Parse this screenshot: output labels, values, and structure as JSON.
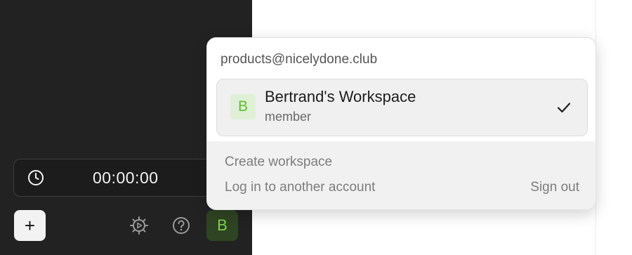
{
  "timer": {
    "time": "00:00:00",
    "icon": "clock-icon"
  },
  "toolbar": {
    "add_label": "+",
    "settings_icon": "gear-icon",
    "help_icon": "help-icon",
    "avatar_initial": "B"
  },
  "account_menu": {
    "email": "products@nicelydone.club",
    "workspaces": [
      {
        "initial": "B",
        "name": "Bertrand's Workspace",
        "role": "member",
        "selected": true
      }
    ],
    "create_workspace": "Create workspace",
    "login_another": "Log in to another account",
    "sign_out": "Sign out"
  },
  "colors": {
    "sidebar_bg": "#222222",
    "accent_green": "#7bd44c",
    "avatar_bg": "#2f4423"
  }
}
